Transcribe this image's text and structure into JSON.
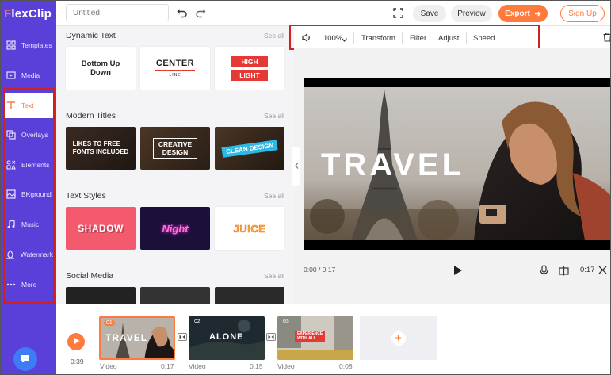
{
  "app": {
    "logo_first": "F",
    "logo_rest": "lexClip"
  },
  "sidebar": {
    "items": [
      {
        "label": "Templates",
        "icon": "templates-icon"
      },
      {
        "label": "Media",
        "icon": "media-icon"
      },
      {
        "label": "Text",
        "icon": "text-icon",
        "active": true
      },
      {
        "label": "Overlays",
        "icon": "overlays-icon"
      },
      {
        "label": "Elements",
        "icon": "elements-icon"
      },
      {
        "label": "BKground",
        "icon": "background-icon"
      },
      {
        "label": "Music",
        "icon": "music-icon"
      },
      {
        "label": "Watermark",
        "icon": "watermark-icon"
      },
      {
        "label": "More",
        "icon": "more-icon"
      }
    ],
    "chat_icon": "chat-icon"
  },
  "topbar": {
    "title_placeholder": "Untitled",
    "save": "Save",
    "preview": "Preview",
    "export": "Export",
    "signup": "Sign Up"
  },
  "library": {
    "sections": [
      {
        "title": "Dynamic Text",
        "see_all": "See all"
      },
      {
        "title": "Modern Titles",
        "see_all": "See all"
      },
      {
        "title": "Text Styles",
        "see_all": "See all"
      },
      {
        "title": "Social Media",
        "see_all": "See all"
      }
    ],
    "dynamic": {
      "c1_line1": "Bottom Up",
      "c1_line2": "Down",
      "c2_line1": "CENTER",
      "c2_line2": "LINE",
      "c3_line1": "HIGH",
      "c3_line2": "LIGHT"
    },
    "modern": {
      "c1_line1": "LIKES TO FREE",
      "c1_line2": "FONTS INCLUDED",
      "c2_line1": "CREATIVE",
      "c2_line2": "DESIGN",
      "c3_line1": "CLEAN DESIGN"
    },
    "styles": {
      "c1": "SHADOW",
      "c2": "Night",
      "c3": "JUICE"
    }
  },
  "toolbar": {
    "volume": "100%",
    "transform": "Transform",
    "filter": "Filter",
    "adjust": "Adjust",
    "speed": "Speed"
  },
  "preview": {
    "title_text": "TRAVEL",
    "time_current": "0:00 / 0:17",
    "time_end": "0:17"
  },
  "timeline": {
    "total_time": "0:39",
    "clips": [
      {
        "num": "01",
        "label": "Video",
        "duration": "0:17",
        "text": "TRAVEL"
      },
      {
        "num": "02",
        "label": "Video",
        "duration": "0:15",
        "text": "ALONE"
      },
      {
        "num": "03",
        "label": "Video",
        "duration": "0:08",
        "text_line1": "EXPERIENCE",
        "text_line2": "WITH ALL"
      }
    ],
    "add_symbol": "+"
  },
  "colors": {
    "brand_purple": "#5a3fd8",
    "accent_orange": "#ff7a3d",
    "highlight_red": "#d21f1f"
  }
}
